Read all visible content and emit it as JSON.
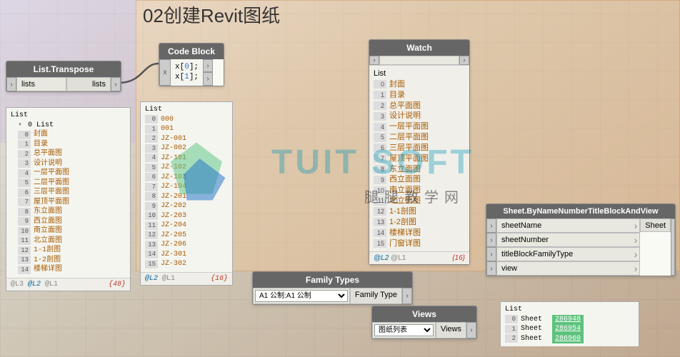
{
  "title": "02创建Revit图纸",
  "nodes": {
    "transpose": {
      "name": "List.Transpose",
      "in": "lists",
      "out": "lists"
    },
    "codeblock": {
      "name": "Code Block",
      "code_lines": [
        "x[0];",
        "x[1];"
      ],
      "port_in": "x"
    },
    "watch": {
      "name": "Watch"
    },
    "family": {
      "name": "Family Types",
      "value": "A1 公制:A1 公制",
      "out": "Family Type"
    },
    "views": {
      "name": "Views",
      "value": "图纸列表",
      "out": "Views"
    },
    "sheet": {
      "name": "Sheet.ByNameNumberTitleBlockAndView",
      "ports_in": [
        "sheetName",
        "sheetNumber",
        "titleBlockFamilyType",
        "view"
      ],
      "port_out": "Sheet"
    }
  },
  "preview_transpose": {
    "header": "List",
    "subheader": "0 List",
    "items": [
      {
        "i": "0",
        "v": "封面"
      },
      {
        "i": "1",
        "v": "目录"
      },
      {
        "i": "2",
        "v": "总平面图"
      },
      {
        "i": "3",
        "v": "设计说明"
      },
      {
        "i": "4",
        "v": "一层平面图"
      },
      {
        "i": "5",
        "v": "二层平面图"
      },
      {
        "i": "6",
        "v": "三层平面图"
      },
      {
        "i": "7",
        "v": "屋顶平面图"
      },
      {
        "i": "8",
        "v": "东立面图"
      },
      {
        "i": "9",
        "v": "西立面图"
      },
      {
        "i": "10",
        "v": "南立面图"
      },
      {
        "i": "11",
        "v": "北立面图"
      },
      {
        "i": "12",
        "v": "1-1剖图"
      },
      {
        "i": "13",
        "v": "1-2剖图"
      },
      {
        "i": "14",
        "v": "楼梯详图"
      }
    ],
    "lace": "@L3 @L2 @L1",
    "count": "{48}"
  },
  "preview_code": {
    "header": "List",
    "items": [
      {
        "i": "0",
        "v": "000"
      },
      {
        "i": "1",
        "v": "001"
      },
      {
        "i": "2",
        "v": "JZ-001"
      },
      {
        "i": "3",
        "v": "JZ-002"
      },
      {
        "i": "4",
        "v": "JZ-101"
      },
      {
        "i": "5",
        "v": "JZ-102"
      },
      {
        "i": "6",
        "v": "JZ-103"
      },
      {
        "i": "7",
        "v": "JZ-104"
      },
      {
        "i": "8",
        "v": "JZ-201"
      },
      {
        "i": "9",
        "v": "JZ-202"
      },
      {
        "i": "10",
        "v": "JZ-203"
      },
      {
        "i": "11",
        "v": "JZ-204"
      },
      {
        "i": "12",
        "v": "JZ-205"
      },
      {
        "i": "13",
        "v": "JZ-206"
      },
      {
        "i": "14",
        "v": "JZ-301"
      },
      {
        "i": "15",
        "v": "JZ-302"
      }
    ],
    "lace": "@L2 @L1",
    "count": "{16}"
  },
  "preview_watch": {
    "header": "List",
    "items": [
      {
        "i": "0",
        "v": "封面"
      },
      {
        "i": "1",
        "v": "目录"
      },
      {
        "i": "2",
        "v": "总平面图"
      },
      {
        "i": "3",
        "v": "设计说明"
      },
      {
        "i": "4",
        "v": "一层平面图"
      },
      {
        "i": "5",
        "v": "二层平面图"
      },
      {
        "i": "6",
        "v": "三层平面图"
      },
      {
        "i": "7",
        "v": "屋顶平面图"
      },
      {
        "i": "8",
        "v": "东立面图"
      },
      {
        "i": "9",
        "v": "西立面图"
      },
      {
        "i": "10",
        "v": "南立面图"
      },
      {
        "i": "11",
        "v": "北立面图"
      },
      {
        "i": "12",
        "v": "1-1剖图"
      },
      {
        "i": "13",
        "v": "1-2剖图"
      },
      {
        "i": "14",
        "v": "楼梯详图"
      },
      {
        "i": "15",
        "v": "门窗详图"
      }
    ],
    "lace": "@L2 @L1",
    "count": "{16}"
  },
  "preview_sheet": {
    "header": "List",
    "items": [
      {
        "i": "0",
        "l": "Sheet",
        "v": "286948"
      },
      {
        "i": "1",
        "l": "Sheet",
        "v": "286954"
      },
      {
        "i": "2",
        "l": "Sheet",
        "v": "286960"
      }
    ]
  },
  "watermark": "TUIT SOFT",
  "watermark2": "腿腿教学网"
}
